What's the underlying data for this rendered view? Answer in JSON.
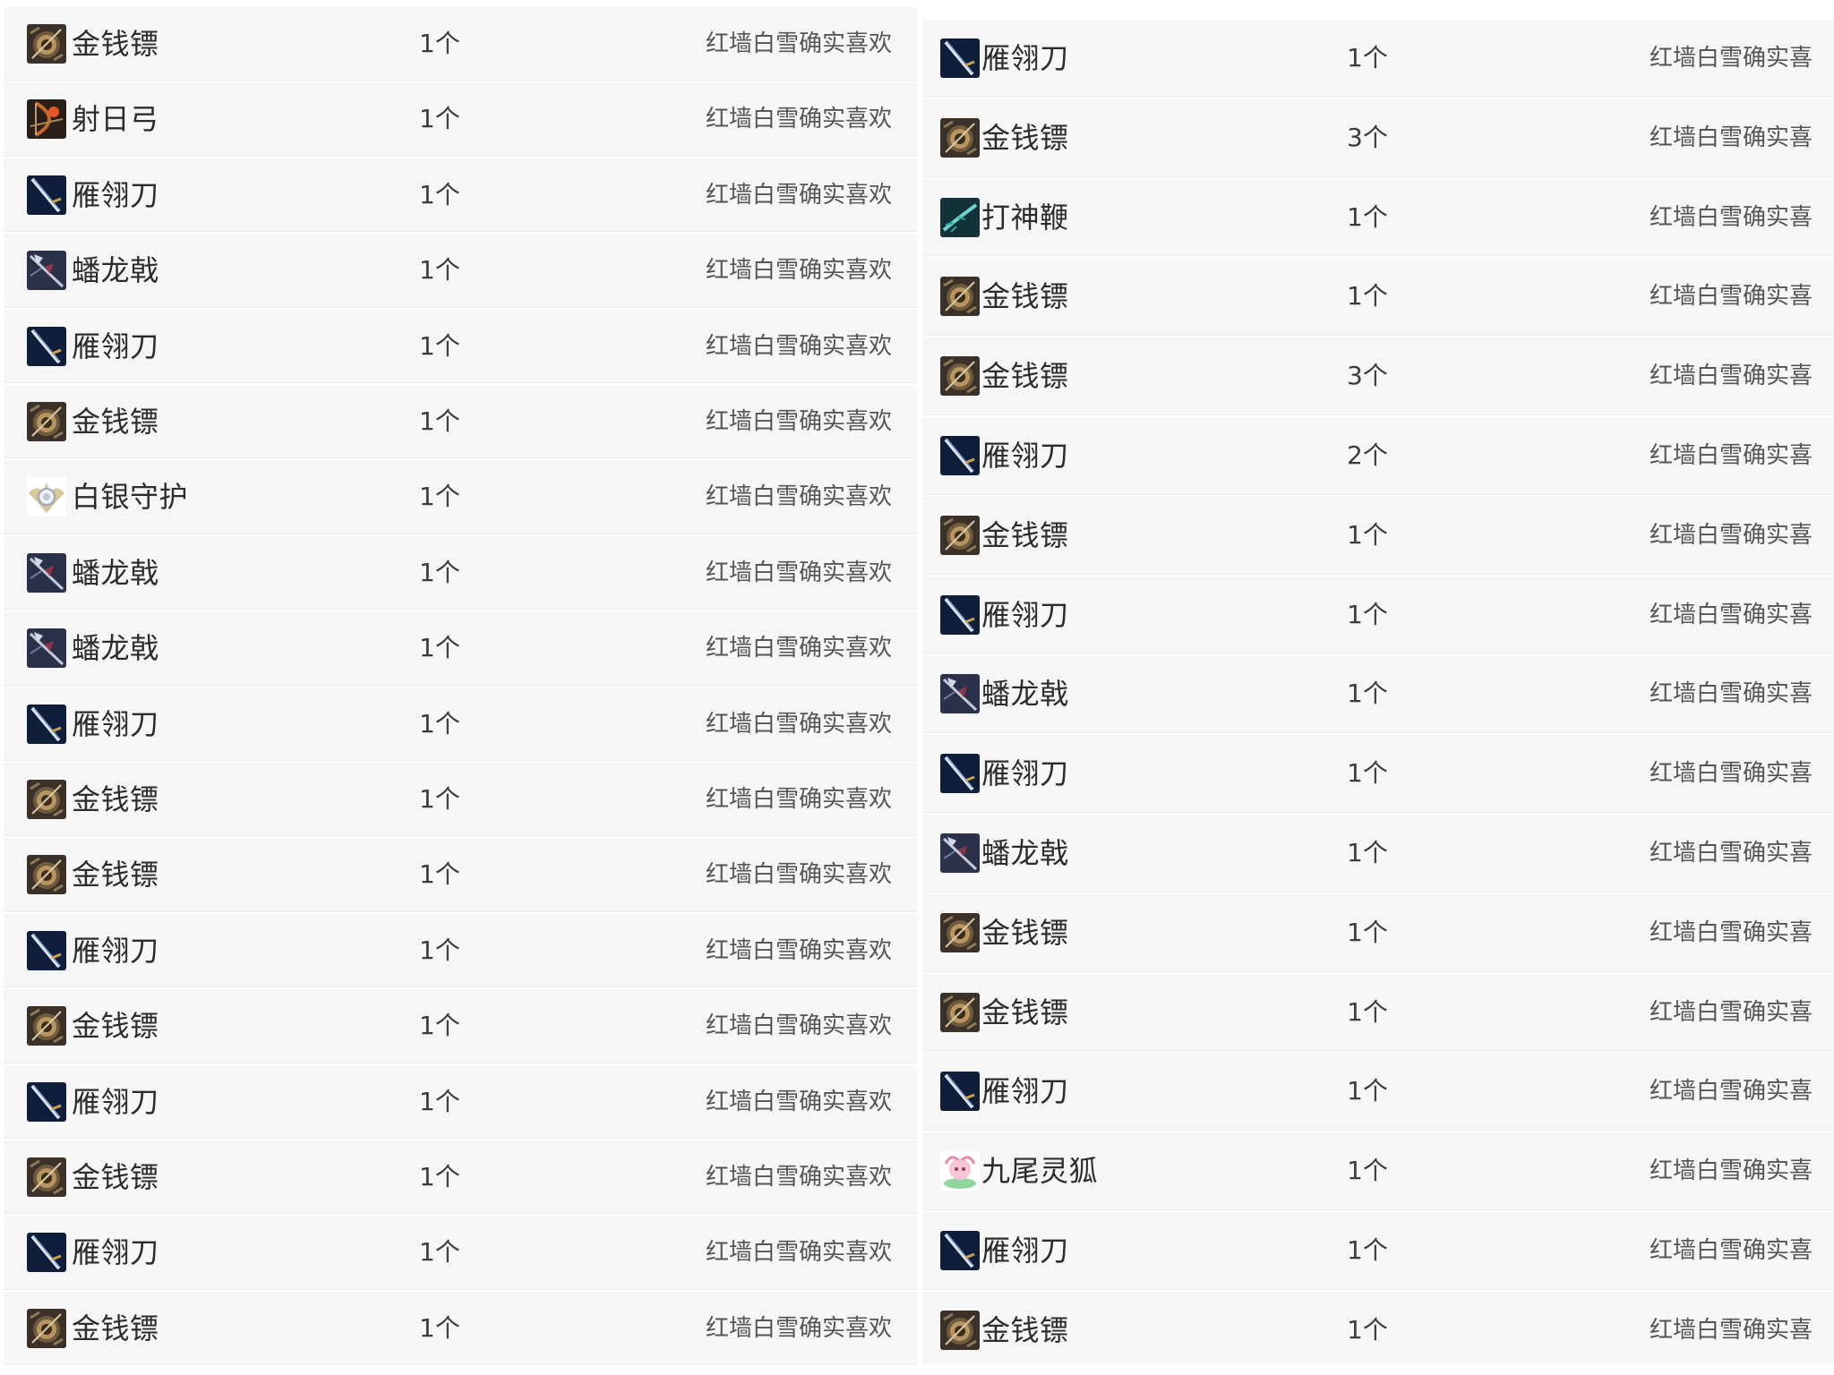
{
  "left_list": [
    {
      "name": "金钱镖",
      "qty": "1个",
      "user": "红墙白雪确实喜欢",
      "icon": "coin-dart-icon"
    },
    {
      "name": "射日弓",
      "qty": "1个",
      "user": "红墙白雪确实喜欢",
      "icon": "sun-bow-icon"
    },
    {
      "name": "雁翎刀",
      "qty": "1个",
      "user": "红墙白雪确实喜欢",
      "icon": "saber-icon"
    },
    {
      "name": "蟠龙戟",
      "qty": "1个",
      "user": "红墙白雪确实喜欢",
      "icon": "halberd-icon"
    },
    {
      "name": "雁翎刀",
      "qty": "1个",
      "user": "红墙白雪确实喜欢",
      "icon": "saber-icon"
    },
    {
      "name": "金钱镖",
      "qty": "1个",
      "user": "红墙白雪确实喜欢",
      "icon": "coin-dart-icon"
    },
    {
      "name": "白银守护",
      "qty": "1个",
      "user": "红墙白雪确实喜欢",
      "icon": "silver-guard-icon"
    },
    {
      "name": "蟠龙戟",
      "qty": "1个",
      "user": "红墙白雪确实喜欢",
      "icon": "halberd-icon"
    },
    {
      "name": "蟠龙戟",
      "qty": "1个",
      "user": "红墙白雪确实喜欢",
      "icon": "halberd-icon"
    },
    {
      "name": "雁翎刀",
      "qty": "1个",
      "user": "红墙白雪确实喜欢",
      "icon": "saber-icon"
    },
    {
      "name": "金钱镖",
      "qty": "1个",
      "user": "红墙白雪确实喜欢",
      "icon": "coin-dart-icon"
    },
    {
      "name": "金钱镖",
      "qty": "1个",
      "user": "红墙白雪确实喜欢",
      "icon": "coin-dart-icon"
    },
    {
      "name": "雁翎刀",
      "qty": "1个",
      "user": "红墙白雪确实喜欢",
      "icon": "saber-icon"
    },
    {
      "name": "金钱镖",
      "qty": "1个",
      "user": "红墙白雪确实喜欢",
      "icon": "coin-dart-icon"
    },
    {
      "name": "雁翎刀",
      "qty": "1个",
      "user": "红墙白雪确实喜欢",
      "icon": "saber-icon"
    },
    {
      "name": "金钱镖",
      "qty": "1个",
      "user": "红墙白雪确实喜欢",
      "icon": "coin-dart-icon"
    },
    {
      "name": "雁翎刀",
      "qty": "1个",
      "user": "红墙白雪确实喜欢",
      "icon": "saber-icon"
    },
    {
      "name": "金钱镖",
      "qty": "1个",
      "user": "红墙白雪确实喜欢",
      "icon": "coin-dart-icon"
    }
  ],
  "right_list": [
    {
      "name": "雁翎刀",
      "qty": "1个",
      "user": "红墙白雪确实喜",
      "icon": "saber-icon"
    },
    {
      "name": "金钱镖",
      "qty": "3个",
      "user": "红墙白雪确实喜",
      "icon": "coin-dart-icon"
    },
    {
      "name": "打神鞭",
      "qty": "1个",
      "user": "红墙白雪确实喜",
      "icon": "god-whip-icon"
    },
    {
      "name": "金钱镖",
      "qty": "1个",
      "user": "红墙白雪确实喜",
      "icon": "coin-dart-icon"
    },
    {
      "name": "金钱镖",
      "qty": "3个",
      "user": "红墙白雪确实喜",
      "icon": "coin-dart-icon"
    },
    {
      "name": "雁翎刀",
      "qty": "2个",
      "user": "红墙白雪确实喜",
      "icon": "saber-icon"
    },
    {
      "name": "金钱镖",
      "qty": "1个",
      "user": "红墙白雪确实喜",
      "icon": "coin-dart-icon"
    },
    {
      "name": "雁翎刀",
      "qty": "1个",
      "user": "红墙白雪确实喜",
      "icon": "saber-icon"
    },
    {
      "name": "蟠龙戟",
      "qty": "1个",
      "user": "红墙白雪确实喜",
      "icon": "halberd-icon"
    },
    {
      "name": "雁翎刀",
      "qty": "1个",
      "user": "红墙白雪确实喜",
      "icon": "saber-icon"
    },
    {
      "name": "蟠龙戟",
      "qty": "1个",
      "user": "红墙白雪确实喜",
      "icon": "halberd-icon"
    },
    {
      "name": "金钱镖",
      "qty": "1个",
      "user": "红墙白雪确实喜",
      "icon": "coin-dart-icon"
    },
    {
      "name": "金钱镖",
      "qty": "1个",
      "user": "红墙白雪确实喜",
      "icon": "coin-dart-icon"
    },
    {
      "name": "雁翎刀",
      "qty": "1个",
      "user": "红墙白雪确实喜",
      "icon": "saber-icon"
    },
    {
      "name": "九尾灵狐",
      "qty": "1个",
      "user": "红墙白雪确实喜",
      "icon": "nine-tail-fox-icon"
    },
    {
      "name": "雁翎刀",
      "qty": "1个",
      "user": "红墙白雪确实喜",
      "icon": "saber-icon"
    },
    {
      "name": "金钱镖",
      "qty": "1个",
      "user": "红墙白雪确实喜",
      "icon": "coin-dart-icon"
    }
  ]
}
